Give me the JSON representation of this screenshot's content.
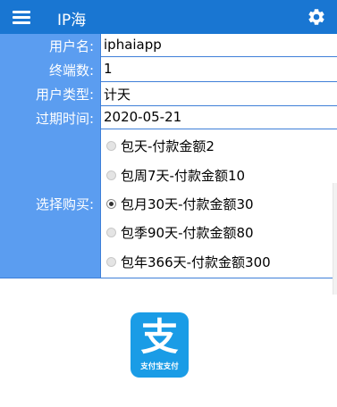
{
  "app": {
    "title": "IP海",
    "bar_color": "#1976d2",
    "label_column_color": "#5b9df0",
    "icons": {
      "menu": "menu-icon",
      "settings": "gear-icon"
    }
  },
  "form": {
    "username": {
      "label": "用户名:",
      "value": "iphaiapp"
    },
    "terminals": {
      "label": "终端数:",
      "value": "1"
    },
    "user_type": {
      "label": "用户类型:",
      "value": "计天"
    },
    "expiry": {
      "label": "过期时间:",
      "value": "2020-05-21"
    },
    "purchase": {
      "label": "选择购买:",
      "selected_index": 2,
      "options": [
        {
          "label": "包天-付款金额2"
        },
        {
          "label": "包周7天-付款金额10"
        },
        {
          "label": "包月30天-付款金额30"
        },
        {
          "label": "包季90天-付款金额80"
        },
        {
          "label": "包年366天-付款金额300"
        }
      ]
    }
  },
  "payment": {
    "alipay_logo_glyph": "支",
    "alipay_logo_text": "支付宝支付",
    "logo_color": "#1a9ce6"
  }
}
